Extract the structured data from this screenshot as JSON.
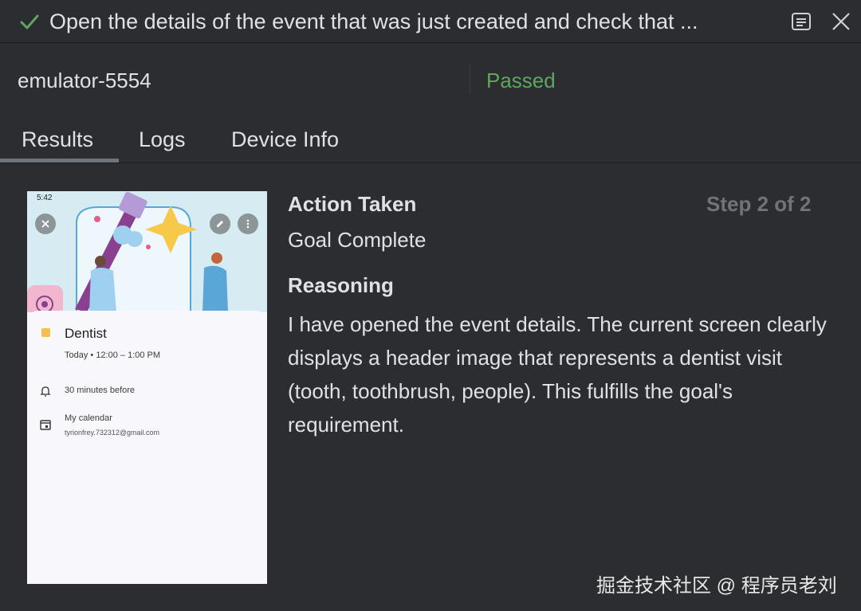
{
  "header": {
    "title": "Open the details of the event that was just created and check that ..."
  },
  "device": {
    "name": "emulator-5554",
    "status": "Passed"
  },
  "tabs": [
    {
      "label": "Results"
    },
    {
      "label": "Logs"
    },
    {
      "label": "Device Info"
    }
  ],
  "screenshot": {
    "status_time": "5:42",
    "event_title": "Dentist",
    "event_time": "Today  •  12:00 – 1:00 PM",
    "reminder": "30 minutes before",
    "calendar_name": "My calendar",
    "calendar_email": "tyrionfrey.732312@gmail.com"
  },
  "result": {
    "action_heading": "Action Taken",
    "step_label": "Step 2 of 2",
    "action_value": "Goal Complete",
    "reasoning_heading": "Reasoning",
    "reasoning_text": "I have opened the event details. The current screen clearly displays a header image that represents a dentist visit (tooth, toothbrush, people). This fulfills the goal's requirement."
  },
  "watermark": "掘金技术社区 @ 程序员老刘",
  "colors": {
    "background": "#2b2d30",
    "success": "#5fa65f",
    "text": "#dfe1e5",
    "muted": "#6f737a",
    "event_color": "#f6bf4f"
  }
}
